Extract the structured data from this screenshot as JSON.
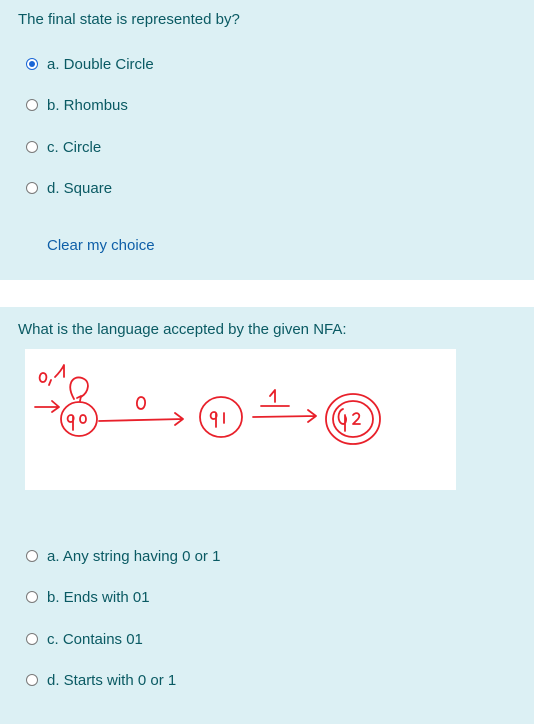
{
  "question1": {
    "prompt": "The final state is represented by?",
    "options": [
      {
        "label": "a. Double Circle",
        "selected": true
      },
      {
        "label": "b. Rhombus",
        "selected": false
      },
      {
        "label": "c. Circle",
        "selected": false
      },
      {
        "label": "d. Square",
        "selected": false
      }
    ],
    "clear_label": "Clear my choice"
  },
  "question2": {
    "prompt": "What is the language accepted by the given NFA:",
    "options": [
      {
        "label": "a. Any string having 0 or 1",
        "selected": false
      },
      {
        "label": "b. Ends with 01",
        "selected": false
      },
      {
        "label": "c. Contains 01",
        "selected": false
      },
      {
        "label": "d. Starts with 0 or 1",
        "selected": false
      }
    ]
  },
  "colors": {
    "panel_bg": "#dcf0f4",
    "text": "#0a5a63",
    "link": "#0e5fa8",
    "radio_selected": "#1a66d6",
    "ink": "#e8202a"
  }
}
